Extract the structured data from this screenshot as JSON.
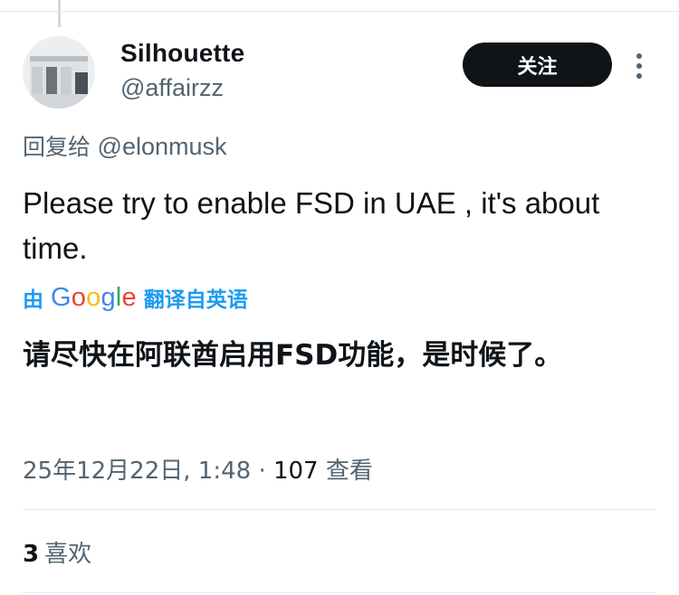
{
  "author": {
    "display_name": "Silhouette",
    "handle": "@affairzz"
  },
  "follow_button": {
    "label": "关注"
  },
  "reply_to": {
    "prefix": "回复给",
    "mention": "@elonmusk"
  },
  "tweet": {
    "text": "Please try to enable FSD in UAE , it's about time."
  },
  "translation": {
    "by_label": "由",
    "provider": "Google",
    "action_label": "翻译自英语",
    "text": "请尽快在阿联酋启用FSD功能，是时候了。"
  },
  "meta": {
    "timestamp": "25年12月22日, 1:48",
    "separator": "·",
    "views_count": "107",
    "views_label": "查看"
  },
  "stats": {
    "likes_count": "3",
    "likes_label": "喜欢"
  },
  "colors": {
    "link": "#1d9bf0",
    "secondary_text": "#536471",
    "primary_text": "#0f1419",
    "follow_bg": "#0f1419"
  }
}
